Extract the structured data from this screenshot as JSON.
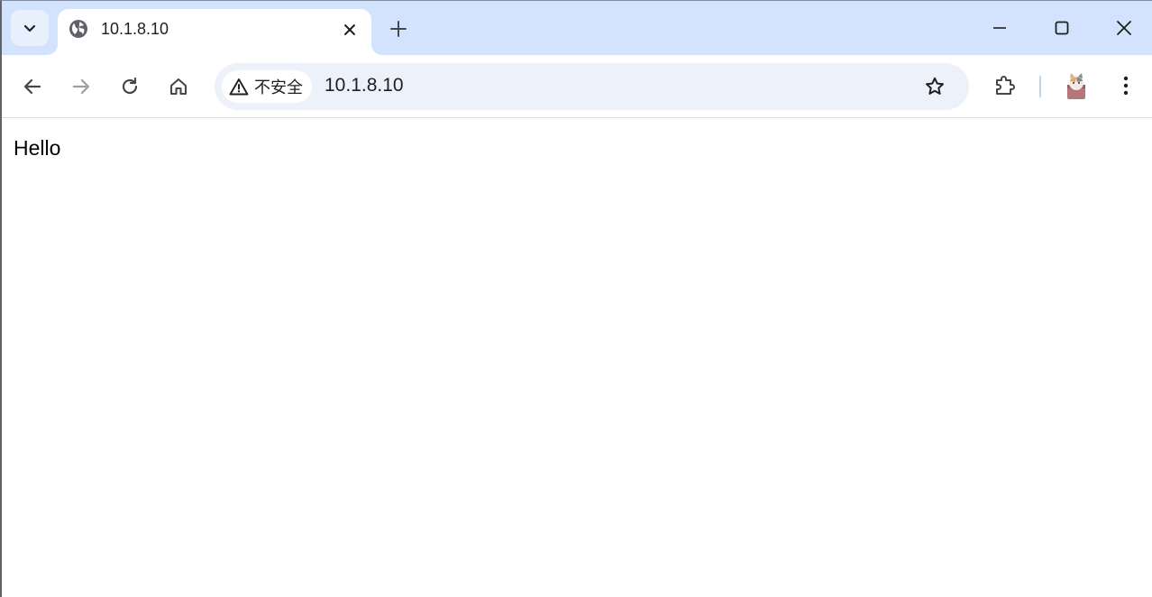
{
  "browser": {
    "tab": {
      "title": "10.1.8.10"
    },
    "address_bar": {
      "security_label": "不安全",
      "url": "10.1.8.10"
    },
    "colors": {
      "tabstrip_bg": "#d3e3fd",
      "omnibox_bg": "#edf2fa",
      "icon": "#474747",
      "icon_disabled": "#9aa0a6"
    },
    "icons": {
      "tab_search": "chevron-down-icon",
      "favicon": "globe-icon",
      "tab_close": "close-icon",
      "new_tab": "plus-icon",
      "back": "arrow-left-icon",
      "forward": "arrow-right-icon",
      "reload": "reload-icon",
      "home": "home-icon",
      "security": "warning-triangle-icon",
      "bookmark": "star-icon",
      "extensions": "puzzle-icon",
      "profile": "avatar-icon",
      "menu": "kebab-menu-icon",
      "minimize": "minimize-icon",
      "maximize": "maximize-icon",
      "close_window": "close-icon"
    }
  },
  "page": {
    "body_text": "Hello"
  }
}
